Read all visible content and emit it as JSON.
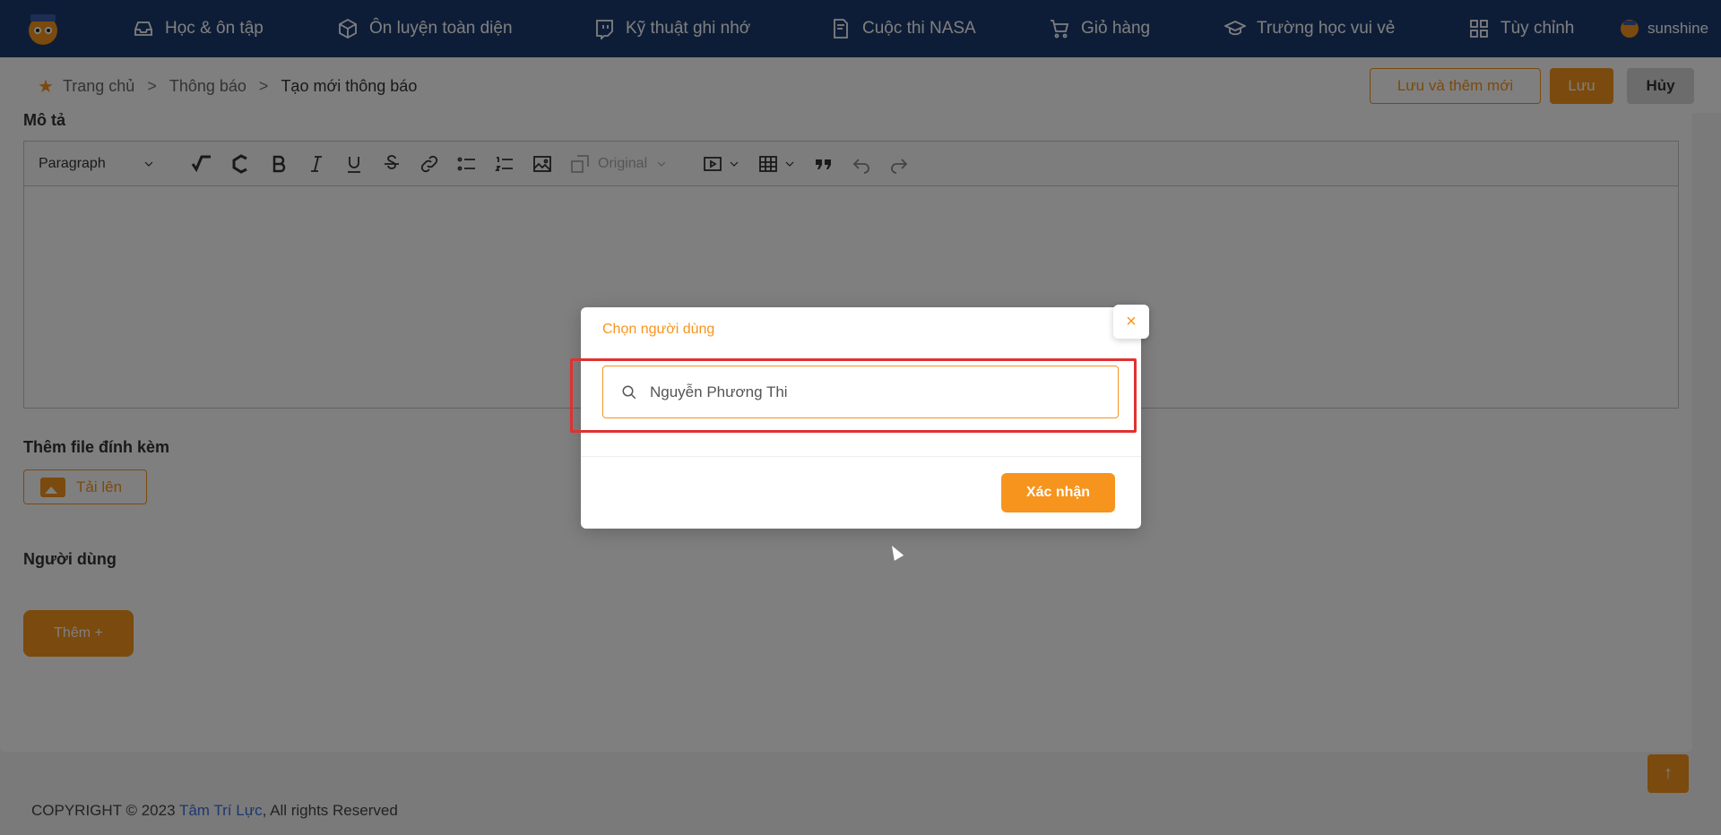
{
  "nav": {
    "items": [
      {
        "label": "Học & ôn tập",
        "icon": "inbox-icon"
      },
      {
        "label": "Ôn luyện toàn diện",
        "icon": "cube-icon"
      },
      {
        "label": "Kỹ thuật ghi nhớ",
        "icon": "twitch-icon"
      },
      {
        "label": "Cuộc thi NASA",
        "icon": "document-icon"
      },
      {
        "label": "Giỏ hàng",
        "icon": "cart-icon"
      },
      {
        "label": "Trường học vui vẻ",
        "icon": "graduation-cap-icon"
      },
      {
        "label": "Tùy chỉnh",
        "icon": "grid-icon"
      }
    ],
    "user_name": "sunshine"
  },
  "breadcrumb": {
    "home": "Trang chủ",
    "sep": ">",
    "section": "Thông báo",
    "current": "Tạo mới thông báo"
  },
  "actions": {
    "save_and_new": "Lưu và thêm mới",
    "save": "Lưu",
    "cancel": "Hủy"
  },
  "form": {
    "description_label": "Mô tả",
    "toolbar": {
      "paragraph": "Paragraph",
      "image_size": "Original"
    },
    "attach_label": "Thêm file đính kèm",
    "upload_label": "Tải lên",
    "users_label": "Người dùng",
    "add_label": "Thêm +"
  },
  "modal": {
    "title": "Chọn người dùng",
    "close": "×",
    "search_value": "Nguyễn Phương Thi",
    "confirm": "Xác nhận"
  },
  "footer": {
    "prefix": "COPYRIGHT © 2023 ",
    "brand": "Tâm Trí Lực",
    "suffix": ", All rights Reserved"
  },
  "colors": {
    "nav_bg": "#1d3a6e",
    "accent": "#f7941d",
    "highlight": "#e03131"
  }
}
